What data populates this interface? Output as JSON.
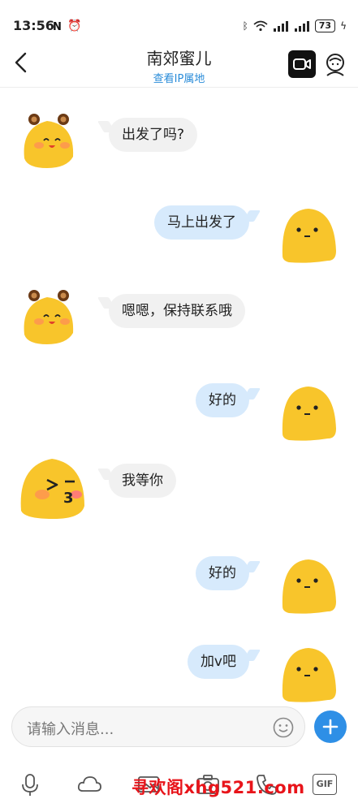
{
  "status_bar": {
    "time": "13:56",
    "battery": "73"
  },
  "header": {
    "contact_name": "南郊蜜儿",
    "ip_link": "查看IP属地"
  },
  "messages": [
    {
      "side": "in",
      "text": "出发了吗?"
    },
    {
      "side": "out",
      "text": "马上出发了"
    },
    {
      "side": "in",
      "text": "嗯嗯，保持联系哦"
    },
    {
      "side": "out",
      "text": "好的"
    },
    {
      "side": "in",
      "text": "我等你"
    },
    {
      "side": "out",
      "text": "好的"
    },
    {
      "side": "out",
      "text": "加v吧"
    }
  ],
  "composer": {
    "placeholder": "请输入消息..."
  },
  "toolbar": {
    "icons": [
      "microphone-icon",
      "cloud-icon",
      "image-icon",
      "camera-icon",
      "phone-icon",
      "gif-icon"
    ],
    "gif_label": "GIF"
  },
  "watermark": "寻欢阁xhg521.com",
  "colors": {
    "accent": "#2e8fe6",
    "incoming_bubble": "#f1f1f1",
    "outgoing_bubble": "#d7eafc",
    "watermark": "#e8141a"
  }
}
